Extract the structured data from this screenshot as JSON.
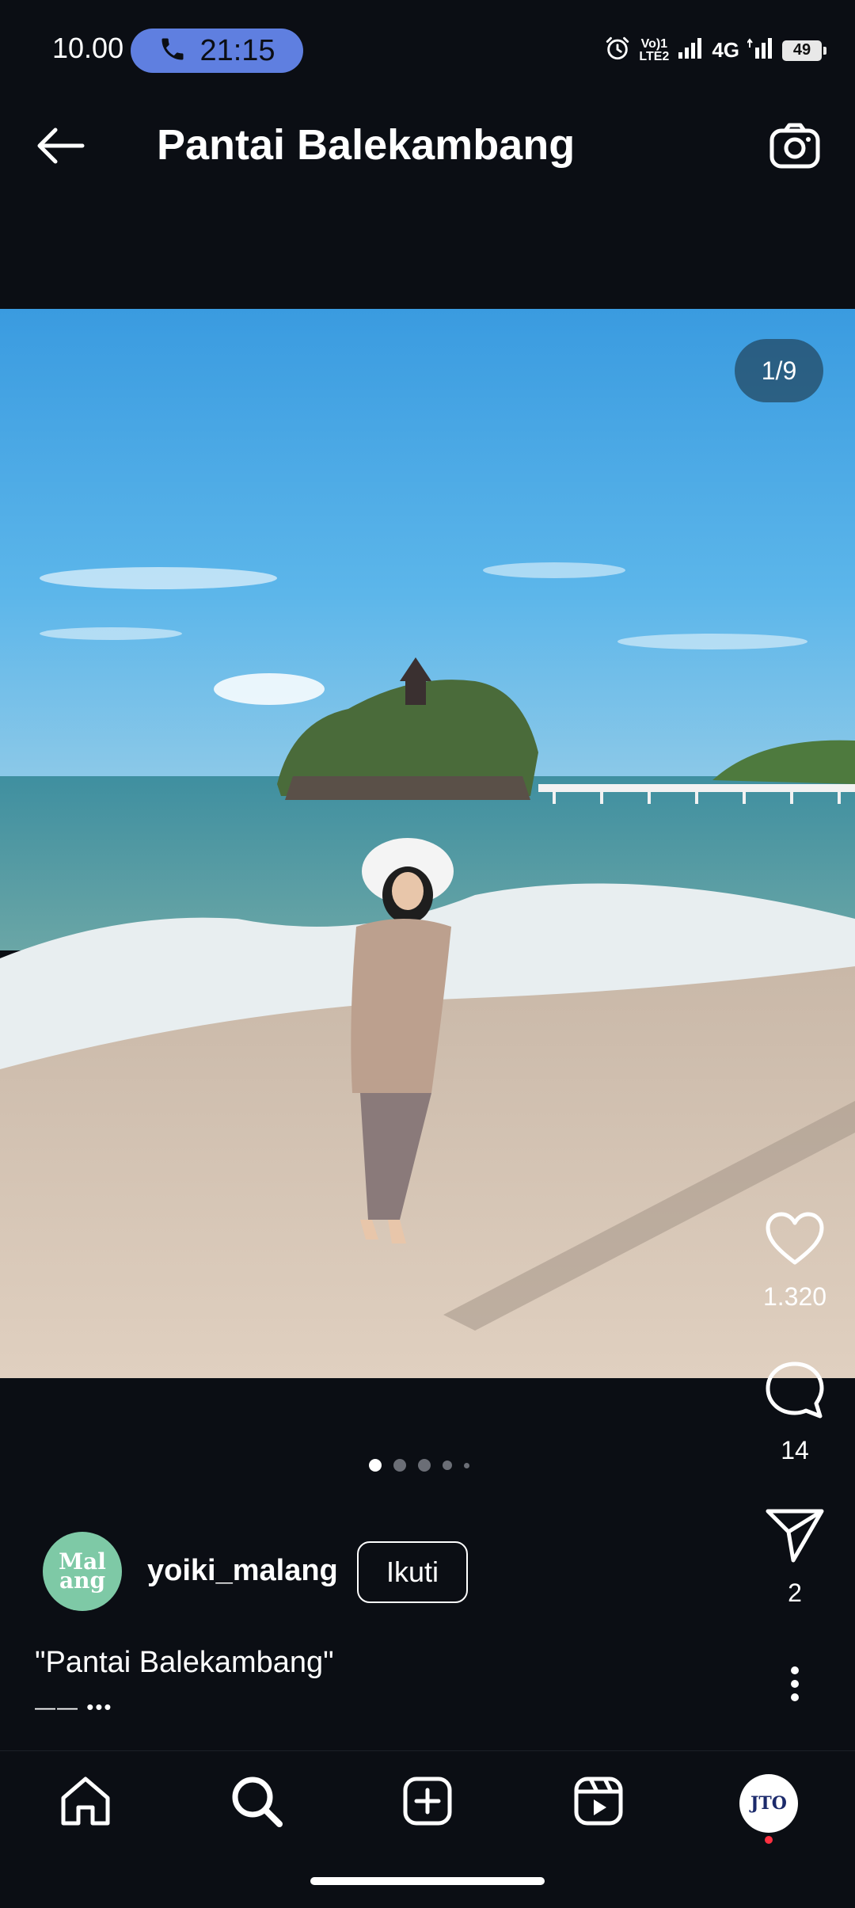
{
  "status_bar": {
    "time": "10.00",
    "call_timer": "21:15",
    "volte_line1": "Vo)1",
    "volte_line2": "LTE2",
    "network": "4G",
    "battery": "49"
  },
  "header": {
    "title": "Pantai Balekambang"
  },
  "post": {
    "photo_counter": "1/9",
    "likes": "1.320",
    "comments": "14",
    "shares": "2",
    "carousel_active_index": 0,
    "author": {
      "avatar_text": "Mal ang",
      "username": "yoiki_malang",
      "follow_label": "Ikuti"
    },
    "caption": "\"Pantai Balekambang\"",
    "caption_more": "—— •••"
  },
  "profile_avatar_text": "JTO",
  "colors": {
    "background": "#0b0e14",
    "call_pill": "#5f7fe0",
    "avatar_green": "#7ec9a6",
    "notification_dot": "#ff3040"
  },
  "icons": {
    "back": "arrow-left-icon",
    "camera": "camera-icon",
    "like": "heart-icon",
    "comment": "comment-icon",
    "share": "paper-plane-icon",
    "more": "more-vertical-icon",
    "home": "home-icon",
    "search": "search-icon",
    "create": "plus-square-icon",
    "reels": "reels-icon"
  }
}
